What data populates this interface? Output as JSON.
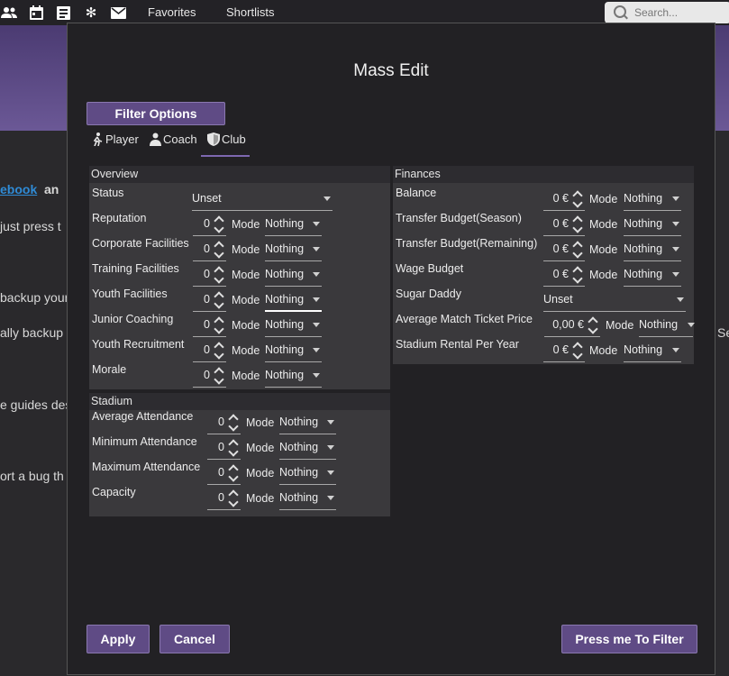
{
  "topbar": {
    "favorites": "Favorites",
    "shortlists": "Shortlists",
    "search_placeholder": "Search..."
  },
  "background": {
    "line1_link": "ebook",
    "line1_rest": "an",
    "line2": "just press t",
    "line3": "backup your",
    "line4": "ally backup",
    "line4_right": "Se",
    "line5": "e guides des",
    "line6": "ort a bug th"
  },
  "dialog": {
    "title": "Mass Edit",
    "filter_options": "Filter Options",
    "tabs": [
      "Player",
      "Coach",
      "Club"
    ],
    "selected_tab": "Club",
    "overview": {
      "header": "Overview",
      "status_label": "Status",
      "status_value": "Unset",
      "rows": [
        {
          "label": "Reputation",
          "value": "0",
          "mode": "Nothing"
        },
        {
          "label": "Corporate Facilities",
          "value": "0",
          "mode": "Nothing"
        },
        {
          "label": "Training Facilities",
          "value": "0",
          "mode": "Nothing"
        },
        {
          "label": "Youth Facilities",
          "value": "0",
          "mode": "Nothing"
        },
        {
          "label": "Junior Coaching",
          "value": "0",
          "mode": "Nothing"
        },
        {
          "label": "Youth Recruitment",
          "value": "0",
          "mode": "Nothing"
        },
        {
          "label": "Morale",
          "value": "0",
          "mode": "Nothing"
        }
      ]
    },
    "stadium": {
      "header": "Stadium",
      "rows": [
        {
          "label": "Average Attendance",
          "value": "0",
          "mode": "Nothing"
        },
        {
          "label": "Minimum Attendance",
          "value": "0",
          "mode": "Nothing"
        },
        {
          "label": "Maximum Attendance",
          "value": "0",
          "mode": "Nothing"
        },
        {
          "label": "Capacity",
          "value": "0",
          "mode": "Nothing"
        }
      ]
    },
    "finances": {
      "header": "Finances",
      "rows": [
        {
          "label": "Balance",
          "value": "0 €",
          "mode": "Nothing"
        },
        {
          "label": "Transfer Budget(Season)",
          "value": "0 €",
          "mode": "Nothing"
        },
        {
          "label": "Transfer Budget(Remaining)",
          "value": "0 €",
          "mode": "Nothing"
        },
        {
          "label": "Wage Budget",
          "value": "0 €",
          "mode": "Nothing"
        }
      ],
      "sugar_label": "Sugar Daddy",
      "sugar_value": "Unset",
      "ticket": {
        "label": "Average Match Ticket Price",
        "value": "0,00 €",
        "mode": "Nothing"
      },
      "rental": {
        "label": "Stadium Rental Per Year",
        "value": "0 €",
        "mode": "Nothing"
      }
    },
    "mode_label": "Mode",
    "apply": "Apply",
    "cancel": "Cancel",
    "press_filter": "Press me To Filter"
  }
}
